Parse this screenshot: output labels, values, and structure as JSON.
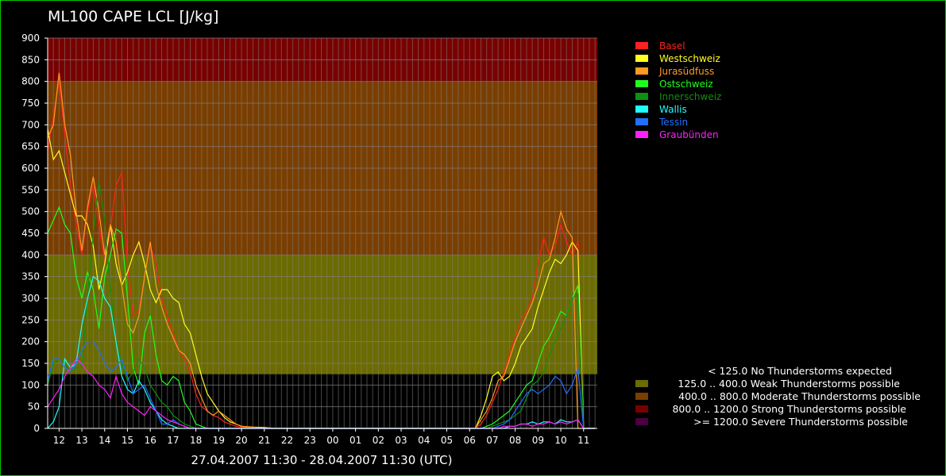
{
  "title": "ML100 CAPE LCL [J/kg]",
  "period": "27.04.2007 11:30 - 28.04.2007 11:30  (UTC)",
  "chart_data": {
    "type": "line",
    "title": "ML100 CAPE LCL [J/kg]",
    "ylim": [
      0,
      900
    ],
    "grid": true,
    "legend_position": "top-right",
    "yticks": [
      "0",
      "50",
      "100",
      "150",
      "200",
      "250",
      "300",
      "350",
      "400",
      "450",
      "500",
      "550",
      "600",
      "650",
      "700",
      "750",
      "800",
      "850",
      "900"
    ],
    "xticks": [
      "12",
      "13",
      "14",
      "15",
      "16",
      "17",
      "18",
      "19",
      "20",
      "21",
      "22",
      "23",
      "00",
      "01",
      "02",
      "03",
      "04",
      "05",
      "06",
      "07",
      "08",
      "09",
      "10",
      "11"
    ],
    "x": [
      11.5,
      11.75,
      12,
      12.25,
      12.5,
      12.75,
      13,
      13.25,
      13.5,
      13.75,
      14,
      14.25,
      14.5,
      14.75,
      15,
      15.25,
      15.5,
      15.75,
      16,
      16.25,
      16.5,
      16.75,
      17,
      17.25,
      17.5,
      17.75,
      18,
      18.25,
      18.5,
      18.75,
      19,
      19.25,
      19.5,
      19.75,
      20,
      20.5,
      21,
      21.5,
      22,
      22.5,
      23,
      23.5,
      24,
      24.5,
      25,
      25.5,
      26,
      26.5,
      27,
      27.5,
      28,
      28.5,
      29,
      29.5,
      30,
      30.25,
      30.5,
      30.75,
      31,
      31.25,
      31.5,
      31.75,
      32,
      32.25,
      32.5,
      32.75,
      33,
      33.25,
      33.5,
      33.75,
      34,
      34.25,
      34.5,
      34.75,
      35,
      35.25,
      35.5
    ],
    "series": [
      {
        "name": "Basel",
        "color": "#ff2020",
        "values": [
          640,
          720,
          800,
          680,
          560,
          470,
          400,
          500,
          560,
          470,
          380,
          460,
          560,
          590,
          380,
          260,
          270,
          350,
          420,
          380,
          300,
          260,
          220,
          180,
          160,
          130,
          80,
          50,
          40,
          30,
          25,
          15,
          10,
          5,
          3,
          2,
          0,
          0,
          0,
          0,
          0,
          0,
          0,
          0,
          0,
          0,
          0,
          0,
          0,
          0,
          0,
          0,
          0,
          0,
          0,
          0,
          10,
          30,
          60,
          90,
          130,
          170,
          210,
          250,
          270,
          300,
          380,
          440,
          400,
          420,
          470,
          430,
          400,
          430
        ]
      },
      {
        "name": "Westschweiz",
        "color": "#ffff20",
        "values": [
          690,
          620,
          640,
          590,
          540,
          490,
          490,
          470,
          420,
          320,
          380,
          470,
          380,
          330,
          360,
          400,
          430,
          380,
          320,
          290,
          320,
          320,
          300,
          290,
          240,
          220,
          170,
          120,
          80,
          60,
          40,
          25,
          15,
          10,
          5,
          3,
          2,
          0,
          0,
          0,
          0,
          0,
          0,
          0,
          0,
          0,
          0,
          0,
          0,
          0,
          0,
          0,
          0,
          0,
          0,
          0,
          30,
          70,
          120,
          130,
          110,
          120,
          150,
          190,
          210,
          230,
          280,
          320,
          360,
          390,
          380,
          400,
          430,
          410
        ]
      },
      {
        "name": "Jurasüdfuss",
        "color": "#ff9a20",
        "values": [
          670,
          700,
          820,
          700,
          630,
          500,
          410,
          510,
          580,
          500,
          400,
          470,
          430,
          330,
          240,
          220,
          260,
          350,
          430,
          330,
          280,
          240,
          210,
          180,
          170,
          150,
          100,
          70,
          40,
          30,
          40,
          30,
          20,
          10,
          5,
          3,
          0,
          0,
          0,
          0,
          0,
          0,
          0,
          0,
          0,
          0,
          0,
          0,
          0,
          0,
          0,
          0,
          0,
          0,
          0,
          0,
          20,
          40,
          70,
          110,
          120,
          160,
          200,
          230,
          260,
          290,
          330,
          380,
          390,
          440,
          500,
          460,
          440
        ]
      },
      {
        "name": "Ostschweiz",
        "color": "#20ff20",
        "values": [
          450,
          480,
          510,
          470,
          450,
          350,
          300,
          360,
          320,
          230,
          350,
          400,
          460,
          450,
          300,
          140,
          100,
          220,
          260,
          170,
          110,
          100,
          120,
          110,
          60,
          40,
          10,
          5,
          0,
          0,
          0,
          0,
          0,
          0,
          0,
          0,
          0,
          0,
          0,
          0,
          0,
          0,
          0,
          0,
          0,
          0,
          0,
          0,
          0,
          0,
          0,
          0,
          0,
          0,
          0,
          0,
          0,
          5,
          10,
          20,
          30,
          40,
          60,
          80,
          100,
          110,
          150,
          190,
          210,
          240,
          270,
          260,
          300,
          330
        ]
      },
      {
        "name": "Innerschweiz",
        "color": "#109010",
        "values": [
          100,
          150,
          160,
          150,
          130,
          140,
          140,
          310,
          450,
          570,
          480,
          320,
          200,
          150,
          110,
          130,
          160,
          140,
          100,
          80,
          60,
          50,
          30,
          20,
          10,
          5,
          0,
          0,
          0,
          0,
          0,
          0,
          0,
          0,
          0,
          0,
          0,
          0,
          0,
          0,
          0,
          0,
          0,
          0,
          0,
          0,
          0,
          0,
          0,
          0,
          0,
          0,
          0,
          0,
          0,
          0,
          0,
          0,
          5,
          10,
          15,
          20,
          30,
          40,
          70,
          100,
          110,
          130,
          170,
          200,
          230,
          260,
          300,
          310
        ]
      },
      {
        "name": "Wallis",
        "color": "#20ffff",
        "values": [
          0,
          15,
          50,
          160,
          140,
          150,
          240,
          300,
          350,
          340,
          300,
          280,
          200,
          120,
          90,
          80,
          110,
          90,
          60,
          40,
          20,
          10,
          5,
          0,
          0,
          0,
          0,
          0,
          0,
          0,
          0,
          0,
          0,
          0,
          0,
          0,
          0,
          0,
          0,
          0,
          0,
          0,
          0,
          0,
          0,
          0,
          0,
          0,
          0,
          0,
          0,
          0,
          0,
          0,
          0,
          0,
          0,
          0,
          0,
          0,
          0,
          5,
          5,
          10,
          10,
          15,
          10,
          15,
          15,
          10,
          20,
          15,
          15,
          20
        ]
      },
      {
        "name": "Tessin",
        "color": "#2070ff",
        "values": [
          110,
          160,
          160,
          140,
          130,
          150,
          180,
          200,
          200,
          180,
          150,
          130,
          140,
          160,
          120,
          80,
          90,
          100,
          70,
          40,
          10,
          10,
          20,
          10,
          5,
          0,
          0,
          0,
          0,
          0,
          0,
          0,
          0,
          0,
          0,
          0,
          0,
          0,
          0,
          0,
          0,
          0,
          0,
          0,
          0,
          0,
          0,
          0,
          0,
          0,
          0,
          0,
          0,
          0,
          0,
          0,
          0,
          0,
          0,
          5,
          10,
          20,
          40,
          60,
          80,
          90,
          80,
          90,
          100,
          120,
          110,
          80,
          100,
          140
        ]
      },
      {
        "name": "Graubünden",
        "color": "#ff20ff",
        "values": [
          50,
          70,
          90,
          120,
          140,
          160,
          150,
          130,
          120,
          100,
          90,
          70,
          120,
          80,
          60,
          50,
          40,
          30,
          50,
          40,
          30,
          20,
          15,
          10,
          5,
          0,
          0,
          0,
          0,
          0,
          0,
          0,
          0,
          0,
          0,
          0,
          0,
          0,
          0,
          0,
          0,
          0,
          0,
          0,
          0,
          0,
          0,
          0,
          0,
          0,
          0,
          0,
          0,
          0,
          0,
          0,
          0,
          0,
          0,
          0,
          5,
          5,
          5,
          10,
          10,
          5,
          10,
          10,
          15,
          10,
          15,
          10,
          15,
          20
        ]
      }
    ],
    "threshold_bands": [
      {
        "from": 125,
        "to": 400,
        "color": "#6b6b00"
      },
      {
        "from": 400,
        "to": 800,
        "color": "#7a3e00"
      },
      {
        "from": 800,
        "to": 900,
        "color": "#780000"
      }
    ],
    "classes": [
      {
        "text": "< 125.0 No Thunderstorms expected",
        "color": ""
      },
      {
        "text": "125.0 .. 400.0 Weak Thunderstorms possible",
        "color": "#6b6b00"
      },
      {
        "text": "400.0 .. 800.0 Moderate Thunderstorms possible",
        "color": "#7a3e00"
      },
      {
        "text": "800.0 .. 1200.0 Strong Thunderstorms possible",
        "color": "#780000"
      },
      {
        "text": ">= 1200.0 Severe Thunderstorms possible",
        "color": "#4a0040"
      }
    ]
  }
}
